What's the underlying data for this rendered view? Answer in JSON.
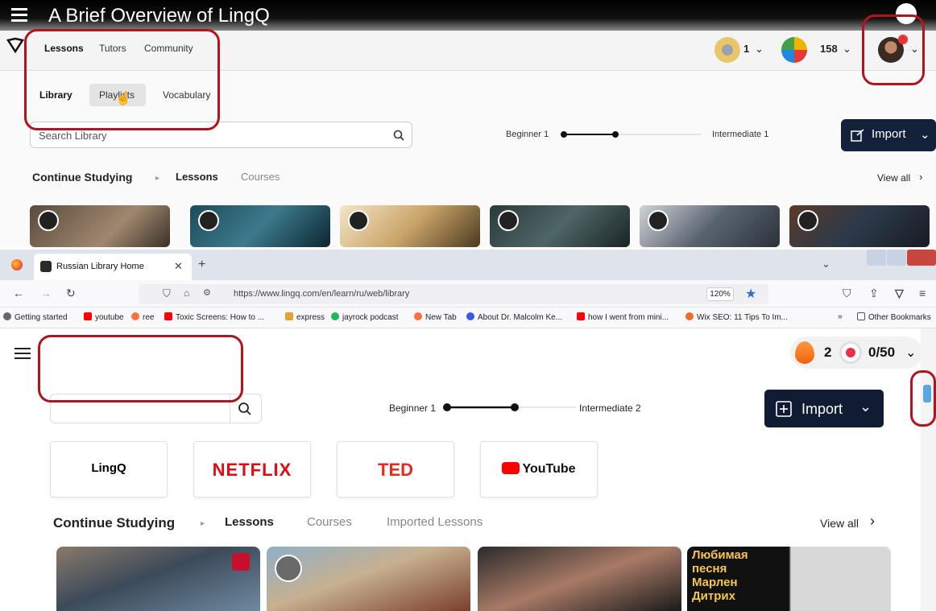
{
  "video": {
    "title": "A Brief Overview of LingQ",
    "nav": {
      "lessons": "Lessons",
      "tutors": "Tutors",
      "community": "Community",
      "coin_count": "1",
      "words_count": "158"
    },
    "sub_nav": {
      "library": "Library",
      "playlists": "Playlists",
      "vocabulary": "Vocabulary"
    },
    "search_placeholder": "Search Library",
    "level_from": "Beginner 1",
    "level_to": "Intermediate 1",
    "import_label": "Import",
    "continue": {
      "title": "Continue Studying",
      "lessons": "Lessons",
      "courses": "Courses",
      "view_all": "View all"
    }
  },
  "browser": {
    "tab_title": "Russian Library Home",
    "url": "https://www.lingq.com/en/learn/ru/web/library",
    "zoom": "120%",
    "bookmarks": [
      {
        "label": "Getting started",
        "color": "#666666"
      },
      {
        "label": "youtube",
        "color": "#ff0000"
      },
      {
        "label": "ree",
        "color": "#ff7139"
      },
      {
        "label": "Toxic Screens: How to ...",
        "color": "#ff0000"
      },
      {
        "label": "express",
        "color": "#e2a33b"
      },
      {
        "label": "jayrock podcast",
        "color": "#1db954"
      },
      {
        "label": "New Tab",
        "color": "#ff7139"
      },
      {
        "label": "About Dr. Malcolm Ke...",
        "color": "#3858e9"
      },
      {
        "label": "how I went from mini...",
        "color": "#ff0000"
      },
      {
        "label": "Wix SEO: 11 Tips To Im...",
        "color": "#f06a2a"
      }
    ],
    "other_bookmarks": "Other Bookmarks"
  },
  "page": {
    "streak": "2",
    "goal": "0/50",
    "level_from": "Beginner 1",
    "level_to": "Intermediate 2",
    "import_label": "Import",
    "brands": {
      "lingq": "LingQ",
      "netflix": "NETFLIX",
      "ted": "TED",
      "youtube": "YouTube"
    },
    "continue": {
      "title": "Continue Studying",
      "lessons": "Lessons",
      "courses": "Courses",
      "imported": "Imported Lessons",
      "view_all": "View all"
    },
    "thumb4_text": [
      "Любимая",
      "песня",
      "Марлен",
      "Дитрих"
    ]
  },
  "colors": {
    "highlight": "#b3131c",
    "import_bg": "#0f1c34",
    "netflix": "#e50914",
    "ted": "#e62b1e",
    "youtube": "#ff0000"
  }
}
